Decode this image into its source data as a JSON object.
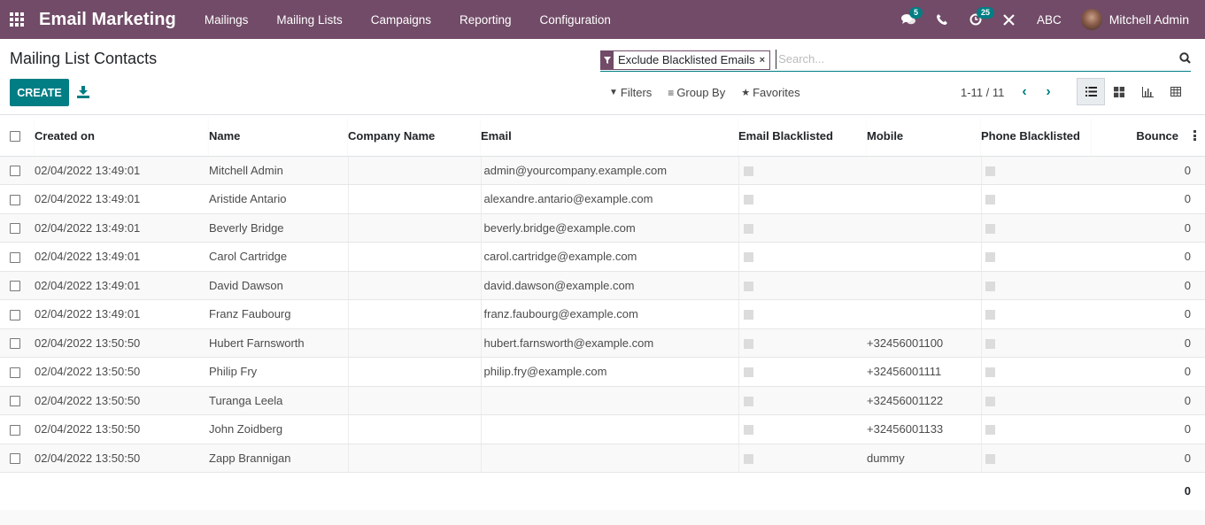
{
  "navbar": {
    "app_title": "Email Marketing",
    "menu": [
      "Mailings",
      "Mailing Lists",
      "Campaigns",
      "Reporting",
      "Configuration"
    ],
    "messages_badge": "5",
    "activities_badge": "25",
    "company": "ABC",
    "user": "Mitchell Admin",
    "icons": [
      "apps-grid-icon",
      "chat-icon",
      "phone-icon",
      "activity-clock-icon",
      "tools-icon"
    ]
  },
  "control_panel": {
    "title": "Mailing List Contacts",
    "create_label": "CREATE",
    "search": {
      "facet_label": "Exclude Blacklisted Emails",
      "placeholder": "Search..."
    },
    "filters_label": "Filters",
    "group_by_label": "Group By",
    "favorites_label": "Favorites",
    "pager": "1-11 / 11",
    "views": [
      "list",
      "kanban",
      "graph",
      "pivot"
    ],
    "active_view": "list"
  },
  "table": {
    "columns": [
      "Created on",
      "Name",
      "Company Name",
      "Email",
      "Email Blacklisted",
      "Mobile",
      "Phone Blacklisted",
      "Bounce"
    ],
    "rows": [
      {
        "created": "02/04/2022 13:49:01",
        "name": "Mitchell Admin",
        "company": "",
        "email": "admin@yourcompany.example.com",
        "email_bl": false,
        "mobile": "",
        "phone_bl": false,
        "bounce": "0"
      },
      {
        "created": "02/04/2022 13:49:01",
        "name": "Aristide Antario",
        "company": "",
        "email": "alexandre.antario@example.com",
        "email_bl": false,
        "mobile": "",
        "phone_bl": false,
        "bounce": "0"
      },
      {
        "created": "02/04/2022 13:49:01",
        "name": "Beverly Bridge",
        "company": "",
        "email": "beverly.bridge@example.com",
        "email_bl": false,
        "mobile": "",
        "phone_bl": false,
        "bounce": "0"
      },
      {
        "created": "02/04/2022 13:49:01",
        "name": "Carol Cartridge",
        "company": "",
        "email": "carol.cartridge@example.com",
        "email_bl": false,
        "mobile": "",
        "phone_bl": false,
        "bounce": "0"
      },
      {
        "created": "02/04/2022 13:49:01",
        "name": "David Dawson",
        "company": "",
        "email": "david.dawson@example.com",
        "email_bl": false,
        "mobile": "",
        "phone_bl": false,
        "bounce": "0"
      },
      {
        "created": "02/04/2022 13:49:01",
        "name": "Franz Faubourg",
        "company": "",
        "email": "franz.faubourg@example.com",
        "email_bl": false,
        "mobile": "",
        "phone_bl": false,
        "bounce": "0"
      },
      {
        "created": "02/04/2022 13:50:50",
        "name": "Hubert Farnsworth",
        "company": "",
        "email": "hubert.farnsworth@example.com",
        "email_bl": false,
        "mobile": "+32456001100",
        "phone_bl": false,
        "bounce": "0"
      },
      {
        "created": "02/04/2022 13:50:50",
        "name": "Philip Fry",
        "company": "",
        "email": "philip.fry@example.com",
        "email_bl": false,
        "mobile": "+32456001111",
        "phone_bl": false,
        "bounce": "0"
      },
      {
        "created": "02/04/2022 13:50:50",
        "name": "Turanga Leela",
        "company": "",
        "email": "",
        "email_bl": false,
        "mobile": "+32456001122",
        "phone_bl": false,
        "bounce": "0"
      },
      {
        "created": "02/04/2022 13:50:50",
        "name": "John Zoidberg",
        "company": "",
        "email": "",
        "email_bl": false,
        "mobile": "+32456001133",
        "phone_bl": false,
        "bounce": "0"
      },
      {
        "created": "02/04/2022 13:50:50",
        "name": "Zapp Brannigan",
        "company": "",
        "email": "",
        "email_bl": false,
        "mobile": "dummy",
        "phone_bl": false,
        "bounce": "0"
      }
    ],
    "footer_bounce_total": "0"
  },
  "colors": {
    "brand": "#714B67",
    "accent": "#017e84"
  }
}
